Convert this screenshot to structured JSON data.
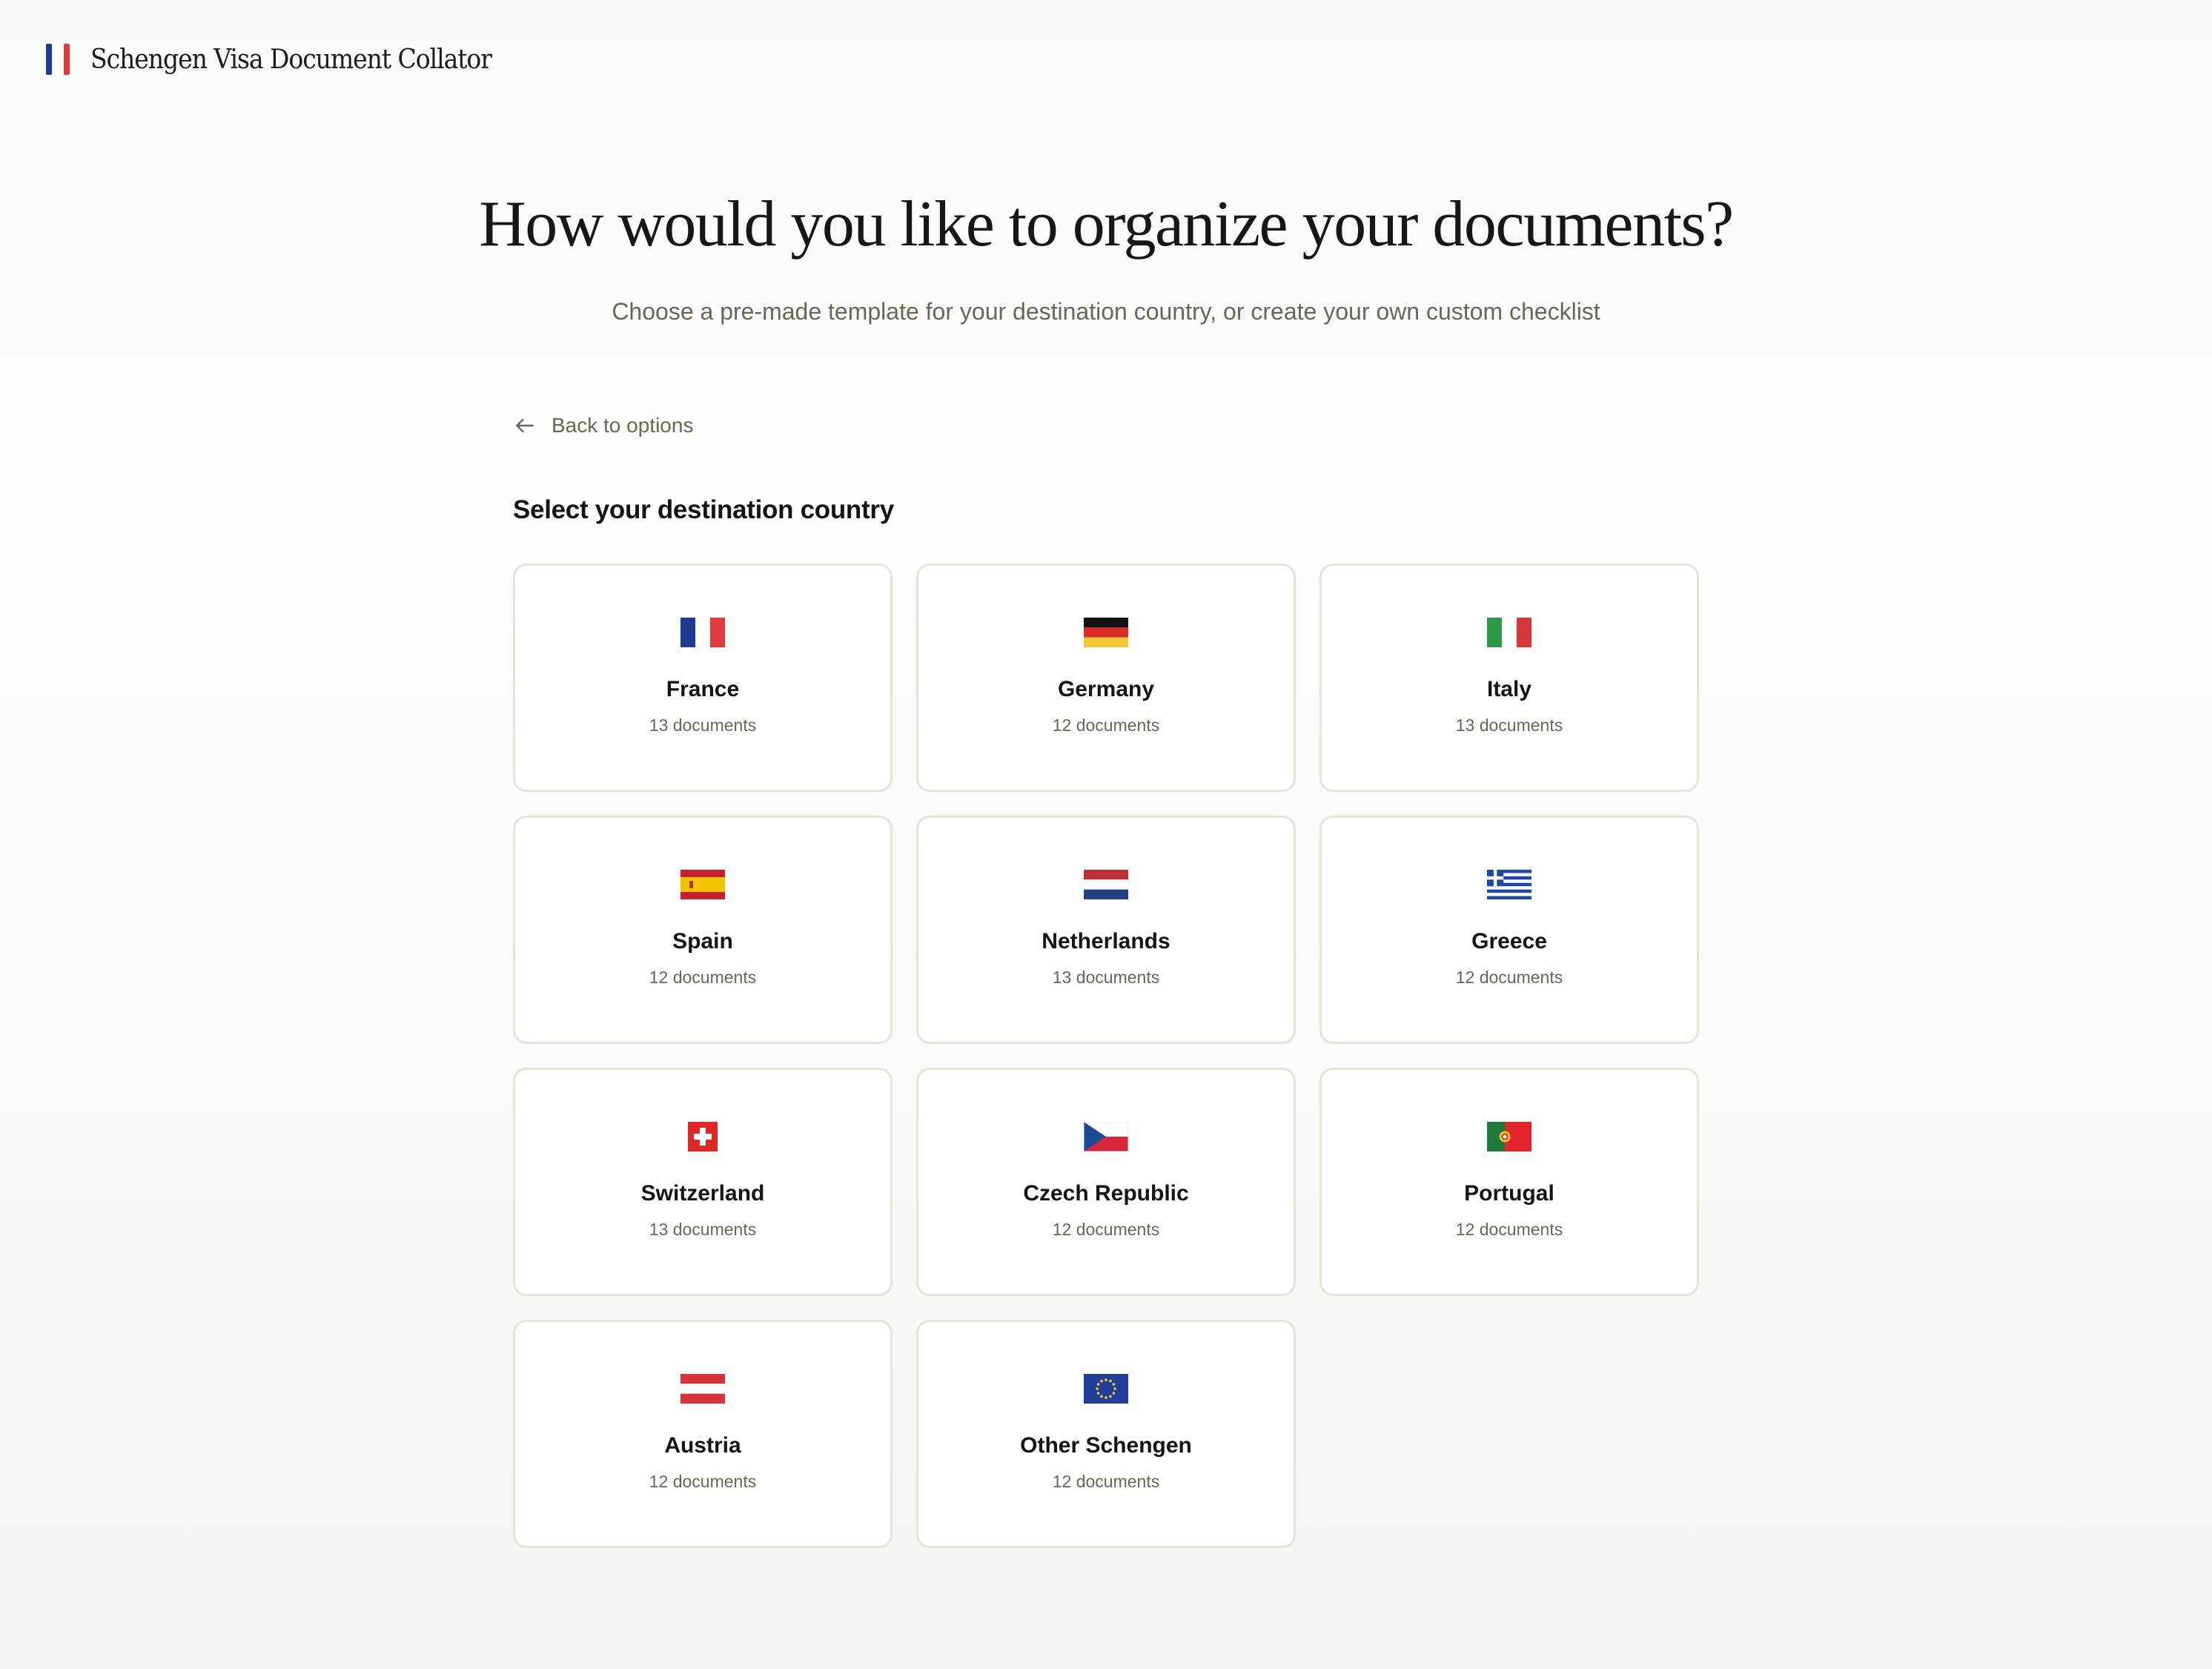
{
  "header": {
    "title": "Schengen Visa Document Collator",
    "logo_colors": [
      "#1f3a93",
      "#e03a3e"
    ]
  },
  "hero": {
    "title": "How would you like to organize your documents?",
    "subtitle": "Choose a pre-made template for your destination country, or create your own custom checklist"
  },
  "nav": {
    "back_label": "Back to options",
    "back_icon": "arrow-left-icon"
  },
  "section": {
    "title": "Select your destination country"
  },
  "countries": [
    {
      "name": "France",
      "count": "13 documents",
      "flag": "france-flag-icon"
    },
    {
      "name": "Germany",
      "count": "12 documents",
      "flag": "germany-flag-icon"
    },
    {
      "name": "Italy",
      "count": "13 documents",
      "flag": "italy-flag-icon"
    },
    {
      "name": "Spain",
      "count": "12 documents",
      "flag": "spain-flag-icon"
    },
    {
      "name": "Netherlands",
      "count": "13 documents",
      "flag": "netherlands-flag-icon"
    },
    {
      "name": "Greece",
      "count": "12 documents",
      "flag": "greece-flag-icon"
    },
    {
      "name": "Switzerland",
      "count": "13 documents",
      "flag": "switzerland-flag-icon"
    },
    {
      "name": "Czech Republic",
      "count": "12 documents",
      "flag": "czech-flag-icon"
    },
    {
      "name": "Portugal",
      "count": "12 documents",
      "flag": "portugal-flag-icon"
    },
    {
      "name": "Austria",
      "count": "12 documents",
      "flag": "austria-flag-icon"
    },
    {
      "name": "Other Schengen",
      "count": "12 documents",
      "flag": "eu-flag-icon"
    }
  ]
}
